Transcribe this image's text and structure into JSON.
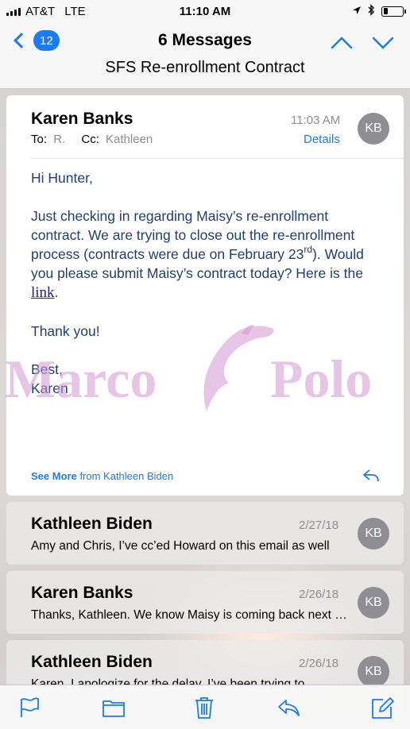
{
  "status_bar": {
    "carrier": "AT&T",
    "network": "LTE",
    "time": "11:10 AM"
  },
  "nav": {
    "back_count": "12",
    "title": "6 Messages",
    "subject": "SFS Re-enrollment Contract"
  },
  "expanded_message": {
    "sender": "Karen Banks",
    "time": "11:03 AM",
    "avatar_initials": "KB",
    "to_label": "To:",
    "to_value": "R.",
    "cc_label": "Cc:",
    "cc_value": "Kathleen",
    "details_label": "Details",
    "greeting": "Hi Hunter,",
    "para1_a": "Just checking in regarding Maisy’s re-enrollment contract.  We are trying to close out the re-enrollment process (contracts were due on February 23",
    "para1_sup": "rd",
    "para1_b": ").  Would you please submit Maisy’s contract today?  Here is the ",
    "link_text": "link",
    "para1_end": ".",
    "thanks": "Thank you!",
    "signoff": "Best,",
    "signature": "Karen",
    "see_more_label": "See More",
    "see_more_from": "from Kathleen Biden"
  },
  "messages": [
    {
      "sender": "Kathleen Biden",
      "date": "2/27/18",
      "avatar_initials": "KB",
      "preview": "Amy and Chris, I’ve cc’ed Howard on this email as well"
    },
    {
      "sender": "Karen Banks",
      "date": "2/26/18",
      "avatar_initials": "KB",
      "preview": "Thanks, Kathleen. We know Maisy is coming back next year"
    },
    {
      "sender": "Kathleen Biden",
      "date": "2/26/18",
      "avatar_initials": "KB",
      "preview": "Karen, I apologize for the delay. I’ve been trying to"
    }
  ],
  "watermark": {
    "left_text": "Marco",
    "right_text": "Polo"
  },
  "toolbar": {
    "icons": [
      "flag-icon",
      "folder-icon",
      "trash-icon",
      "reply-icon",
      "compose-icon"
    ]
  },
  "colors": {
    "accent": "#1a7cf5",
    "body_text": "#1f3f73",
    "avatar_bg": "#8e8e93",
    "watermark": "#d296d2"
  }
}
